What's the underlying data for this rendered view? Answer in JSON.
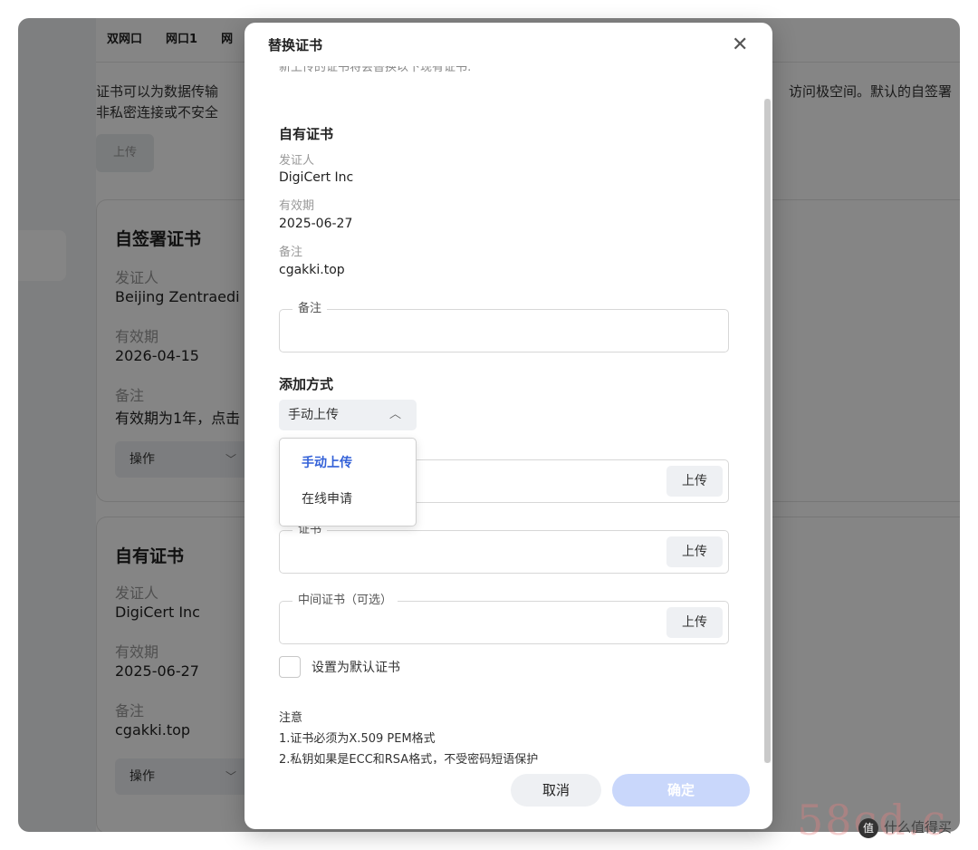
{
  "background": {
    "tabs": [
      "双网口",
      "网口1",
      "网"
    ],
    "desc_line1": "证书可以为数据传输",
    "desc_line2": "非私密连接或不安全",
    "desc_right": "访问极空间。默认的自签署",
    "upload_label": "上传",
    "cards": [
      {
        "title": "自签署证书",
        "issuer_label": "发证人",
        "issuer": "Beijing Zentraedi",
        "validity_label": "有效期",
        "validity": "2026-04-15",
        "note_label": "备注",
        "note": "有效期为1年，点击",
        "action_label": "操作"
      },
      {
        "title": "自有证书",
        "issuer_label": "发证人",
        "issuer": "DigiCert Inc",
        "validity_label": "有效期",
        "validity": "2025-06-27",
        "note_label": "备注",
        "note": "cgakki.top",
        "action_label": "操作"
      }
    ]
  },
  "modal": {
    "title": "替换证书",
    "cut_text": "新上传的证书将会替换以下现有证书:",
    "current_cert": {
      "title": "自有证书",
      "issuer_label": "发证人",
      "issuer": "DigiCert Inc",
      "validity_label": "有效期",
      "validity": "2025-06-27",
      "note_label": "备注",
      "note": "cgakki.top"
    },
    "note_field_label": "备注",
    "method_label": "添加方式",
    "method_selected": "手动上传",
    "method_options": [
      "手动上传",
      "在线申请"
    ],
    "cert_field_label": "证书",
    "intermediate_field_label": "中间证书（可选）",
    "upload_label": "上传",
    "default_checkbox_label": "设置为默认证书",
    "notes_title": "注意",
    "notes": [
      "1.证书必须为X.509 PEM格式",
      "2.私钥如果是ECC和RSA格式，不受密码短语保护"
    ],
    "cancel_label": "取消",
    "ok_label": "确定"
  },
  "watermark": {
    "brand_fragment": "58c",
    "brand_tail": "d.c",
    "badge": "值",
    "text": "什么值得买"
  },
  "colors": {
    "accent": "#3361d8",
    "ok_disabled": "#c9d7fb",
    "overlay": "rgba(0,0,0,0.48)"
  }
}
